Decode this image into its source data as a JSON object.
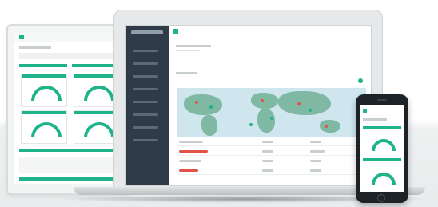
{
  "scene": {
    "devices": [
      "tablet",
      "laptop",
      "phone"
    ],
    "accent_color": "#1fb38c",
    "sidebar_color": "#2f3c47",
    "marker_colors": [
      "#e4524c",
      "#1fb38c"
    ]
  }
}
